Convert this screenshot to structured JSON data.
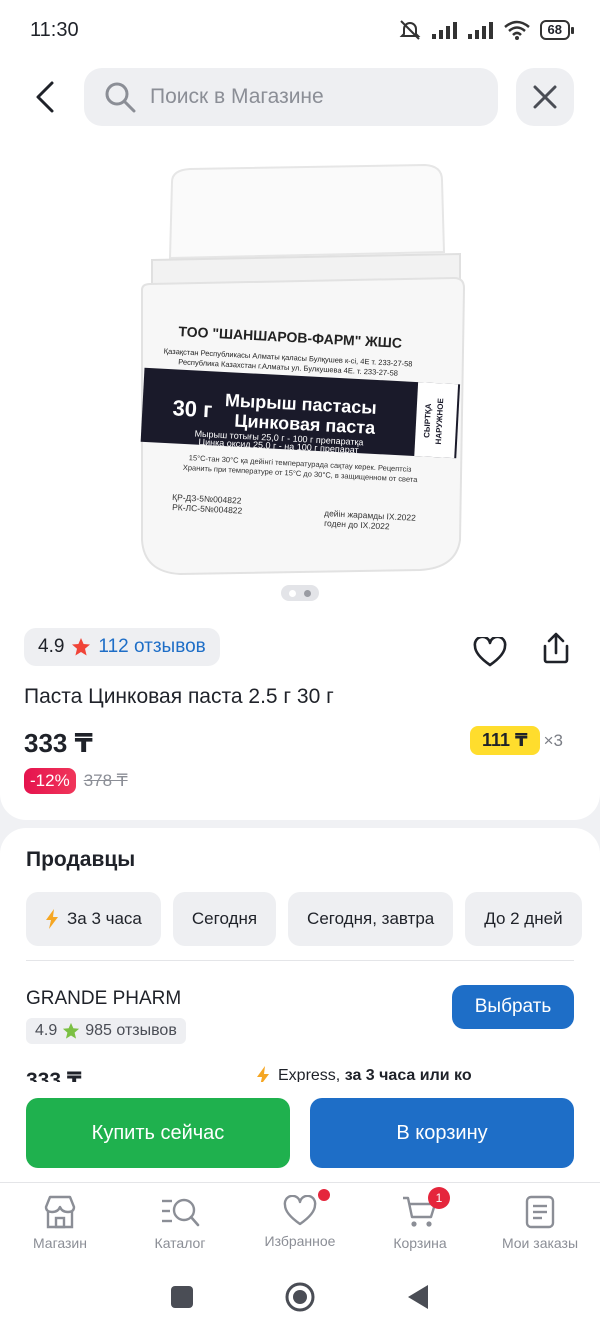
{
  "status_bar": {
    "time": "11:30",
    "battery": "68"
  },
  "search": {
    "placeholder": "Поиск в Магазине"
  },
  "product": {
    "rating": "4.9",
    "reviews": "112 отзывов",
    "title": "Паста Цинковая паста 2.5 г 30 г",
    "price": "333 ₸",
    "installment_amount": "111 ₸",
    "installment_times": "×3",
    "discount": "-12%",
    "old_price": "378 ₸",
    "gallery_pages": 2,
    "gallery_current": 1,
    "image_label": {
      "company": "ТОО \"ШАНШАРОВ-ФАРМ\" ЖШС",
      "address_kz": "Қазақстан Республикасы Алматы қаласы Булқушев к-сі, 4Е т. 233-27-58",
      "address_ru": "Республика Казахстан г.Алматы ул. Булкушева 4Е. т. 233-27-58",
      "weight": "30 г",
      "name_kz": "Мырыш пастасы",
      "name_ru": "Цинковая паста",
      "composition_kz": "Мырыш тотығы 25,0 г - 100 г препаратқа",
      "composition_ru": "Цинка оксид 25,0 г - на 100 г препарат",
      "side_kz": "СЫРТҚА",
      "side_ru": "НАРУЖНОЕ",
      "storage_kz": "15°С-тан 30°С қа дейінгі температурада сақтау керек. Рецептсіз",
      "storage_ru": "Хранить при температуре от 15°С до 30°С, в защищенном от света",
      "reg_kz": "ҚР-ДЗ-5№004822",
      "reg_ru": "РК-ЛС-5№004822",
      "expiry_kz": "дейін жарамды IX.2022",
      "expiry_ru": "годен до IX.2022"
    }
  },
  "sellers": {
    "title": "Продавцы",
    "filters": [
      "За 3 часа",
      "Сегодня",
      "Сегодня, завтра",
      "До 2 дней"
    ],
    "seller": {
      "name": "GRANDE PHARM",
      "rating": "4.9",
      "reviews": "985 отзывов",
      "choose_label": "Выбрать",
      "price": "333 ₸",
      "delivery_prefix": "Express,",
      "delivery_bold": "за 3 часа или ко"
    }
  },
  "actions": {
    "buy_now": "Купить сейчас",
    "to_cart": "В корзину"
  },
  "nav": {
    "items": [
      {
        "label": "Магазин",
        "icon": "store-icon"
      },
      {
        "label": "Каталог",
        "icon": "catalog-icon"
      },
      {
        "label": "Избранное",
        "icon": "heart-icon"
      },
      {
        "label": "Корзина",
        "icon": "cart-icon"
      },
      {
        "label": "Мои заказы",
        "icon": "orders-icon"
      }
    ],
    "cart_badge": "1"
  },
  "colors": {
    "accent_blue": "#1e6ec7",
    "buy_green": "#1fb14e",
    "installment_yellow": "#ffdd2d",
    "discount_red": "#e5134e",
    "star_red": "#f04438",
    "star_green": "#7bc043"
  }
}
